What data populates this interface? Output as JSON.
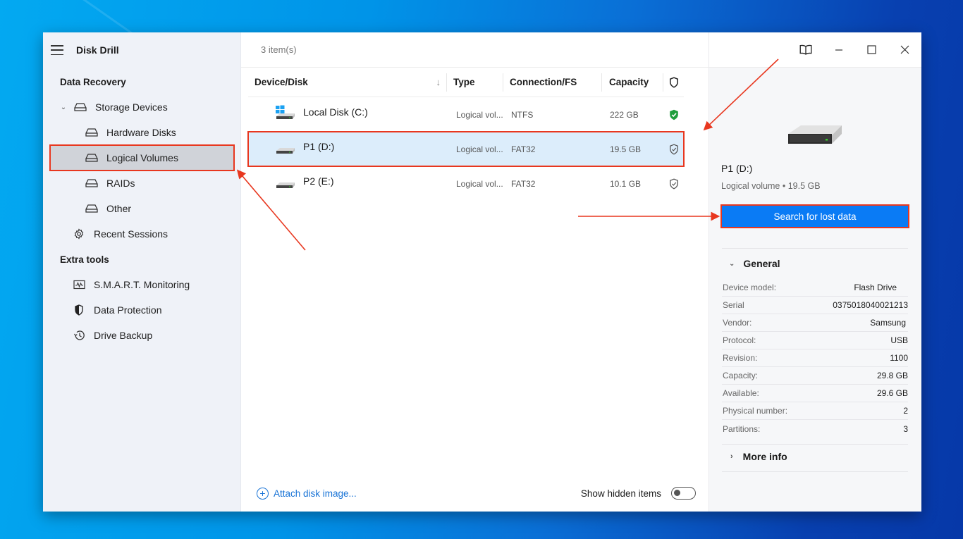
{
  "app": {
    "title": "Disk Drill",
    "accent_color": "#0a7bf5",
    "annotation_color": "#e8371f"
  },
  "sidebar": {
    "sections": [
      {
        "title": "Data Recovery",
        "items": [
          {
            "label": "Storage Devices",
            "icon": "drive-icon",
            "expanded": true
          },
          {
            "label": "Hardware Disks",
            "icon": "drive-icon"
          },
          {
            "label": "Logical Volumes",
            "icon": "drive-icon",
            "selected": true
          },
          {
            "label": "RAIDs",
            "icon": "drive-icon"
          },
          {
            "label": "Other",
            "icon": "drive-icon"
          },
          {
            "label": "Recent Sessions",
            "icon": "gear-icon"
          }
        ]
      },
      {
        "title": "Extra tools",
        "items": [
          {
            "label": "S.M.A.R.T. Monitoring",
            "icon": "monitor-pulse-icon"
          },
          {
            "label": "Data Protection",
            "icon": "shield-half-icon"
          },
          {
            "label": "Drive Backup",
            "icon": "history-icon"
          }
        ]
      }
    ]
  },
  "main": {
    "item_count": "3 item(s)",
    "columns": [
      "Device/Disk",
      "Type",
      "Connection/FS",
      "Capacity"
    ],
    "sort_indicator": "↓",
    "rows": [
      {
        "name": "Local Disk (C:)",
        "type": "Logical vol...",
        "fs": "NTFS",
        "capacity": "222 GB",
        "protection": "protected",
        "icon": "windows-drive-icon"
      },
      {
        "name": "P1 (D:)",
        "type": "Logical vol...",
        "fs": "FAT32",
        "capacity": "19.5 GB",
        "protection": "unprotected",
        "icon": "drive-icon",
        "selected": true
      },
      {
        "name": "P2 (E:)",
        "type": "Logical vol...",
        "fs": "FAT32",
        "capacity": "10.1 GB",
        "protection": "unprotected",
        "icon": "drive-icon"
      }
    ],
    "footer": {
      "attach_label": "Attach disk image...",
      "show_hidden_label": "Show hidden items",
      "show_hidden_on": false
    }
  },
  "details": {
    "name": "P1 (D:)",
    "subtitle": "Logical volume • 19.5 GB",
    "search_button": "Search for lost data",
    "general_title": "General",
    "properties": [
      {
        "key": "Device model:",
        "value": "Flash Drive"
      },
      {
        "key": "Serial",
        "value": "0375018040021213"
      },
      {
        "key": "Vendor:",
        "value": "Samsung"
      },
      {
        "key": "Protocol:",
        "value": "USB"
      },
      {
        "key": "Revision:",
        "value": "1100"
      },
      {
        "key": "Capacity:",
        "value": "29.8 GB"
      },
      {
        "key": "Available:",
        "value": "29.6 GB"
      },
      {
        "key": "Physical number:",
        "value": "2"
      },
      {
        "key": "Partitions:",
        "value": "3"
      }
    ],
    "more_info_title": "More info"
  }
}
